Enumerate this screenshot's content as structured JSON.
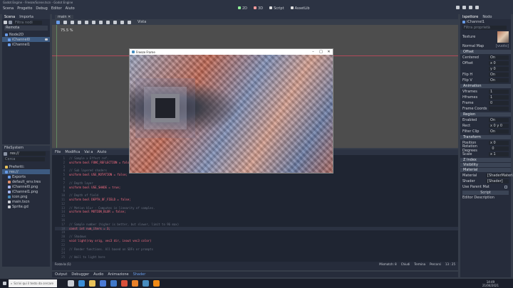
{
  "menubar": {
    "items": [
      "Scena",
      "Progetto",
      "Debug",
      "Editor",
      "Aiuto"
    ],
    "workspaces": [
      "2D",
      "3D",
      "Script",
      "AssetLib"
    ],
    "window_title": "Godot Engine - Freeze/Scene.tscn - Godot Engine"
  },
  "scene_panel": {
    "tabs": [
      "Scena",
      "Importa"
    ],
    "filter_placeholder": "Filtra nodi",
    "root_label": "Remota",
    "nodes": [
      "Node2D",
      "iChannel0",
      "iChannel1"
    ]
  },
  "filesystem_panel": {
    "title": "FileSystem",
    "path": "res://",
    "search_placeholder": "Cerca",
    "items": [
      "Preferiti:",
      "res://",
      "Exports",
      "default_env.tres",
      "iChannel0.png",
      "iChannel1.png",
      "icon.png",
      "main.tscn",
      "Sprite.gd"
    ]
  },
  "viewport": {
    "tab": "main",
    "zoom": "75.5 %",
    "toolbar_right": "Vista"
  },
  "game_window": {
    "title": "Freeze Frame"
  },
  "script_editor": {
    "menus": [
      "File",
      "Modifica",
      "Vai a",
      "Aiuto"
    ],
    "lines": [
      "// Sample x Effect ref.",
      "uniform bool FUNC_REFLECTION = false;",
      "",
      "// Sub layered shaders",
      "uniform bool USE_ROTATION = false;",
      "",
      "// Depth layer",
      "uniform bool USE_SHADE = true;",
      "",
      "// Depth of field",
      "uniform bool DEPTH_OF_FIELD = false;",
      "",
      "// Motion blur - Computes in linearity of samples.",
      "uniform bool MOTION_BLUR = false;",
      "",
      "",
      "// Sample number (higher is better, but slower, limit to 96 max)",
      "const int num_iters = 3;",
      "",
      "// Shadows",
      "void light(ray orig, vec3 dir, inout vec3 color)",
      "",
      "// Render functions. All based on SDFs or prompts",
      "",
      "// Wall to light here"
    ],
    "status_left": "Forza la (1)",
    "status_mid": "Mismatch: 8",
    "status_items": [
      "Chiudi",
      "Termina",
      "Percorsi"
    ],
    "status_right": "13 : 25"
  },
  "bottom_tabs": [
    "Output",
    "Debugger",
    "Audio",
    "Animazione",
    "Shader"
  ],
  "inspector": {
    "tabs": [
      "Ispettore",
      "Nodo"
    ],
    "node_name": "iChannel1",
    "filter_placeholder": "Filtra proprietà",
    "rows": [
      {
        "label": "Texture",
        "value": "[immagine]"
      },
      {
        "label": "Normal Map",
        "value": "[vuoto]"
      }
    ],
    "sections": [
      {
        "title": "Offset",
        "rows": [
          [
            "Centered",
            "On"
          ],
          [
            "Offset",
            "x 0"
          ],
          [
            "",
            "y 0"
          ],
          [
            "Flip H",
            "On"
          ],
          [
            "Flip V",
            "On"
          ]
        ]
      },
      {
        "title": "Animation",
        "rows": [
          [
            "Vframes",
            "1"
          ],
          [
            "Hframes",
            "1"
          ],
          [
            "Frame",
            "0"
          ],
          [
            "Frame Coords",
            ""
          ]
        ]
      },
      {
        "title": "Region",
        "rows": [
          [
            "Enabled",
            "On"
          ],
          [
            "Rect",
            "x 0  y 0"
          ],
          [
            "Filter Clip",
            "On"
          ]
        ]
      },
      {
        "title": "Transform",
        "rows": [
          [
            "Position",
            "x 0"
          ],
          [
            "Rotation Degrees",
            "0"
          ],
          [
            "Scale",
            "x 1"
          ]
        ]
      }
    ],
    "bottom_sections": [
      "Z Index",
      "Visibility",
      "Material"
    ],
    "material_rows": [
      [
        "Material",
        "[ShaderMaterial]"
      ],
      [
        "Shader",
        "[Shader]"
      ]
    ],
    "use_parent": "Use Parent Mat",
    "button": "Script",
    "foot": "Editor Description"
  },
  "taskbar": {
    "search_placeholder": "Scrivi qui il testo da cercare",
    "time": "14:49",
    "date": "21/04/2021"
  },
  "colors": {
    "accent": "#699ce8",
    "panel": "#262c3b",
    "menubar": "#363d4a",
    "viewport": "#4d4d4d",
    "taskbar": "#1b1f2b"
  }
}
